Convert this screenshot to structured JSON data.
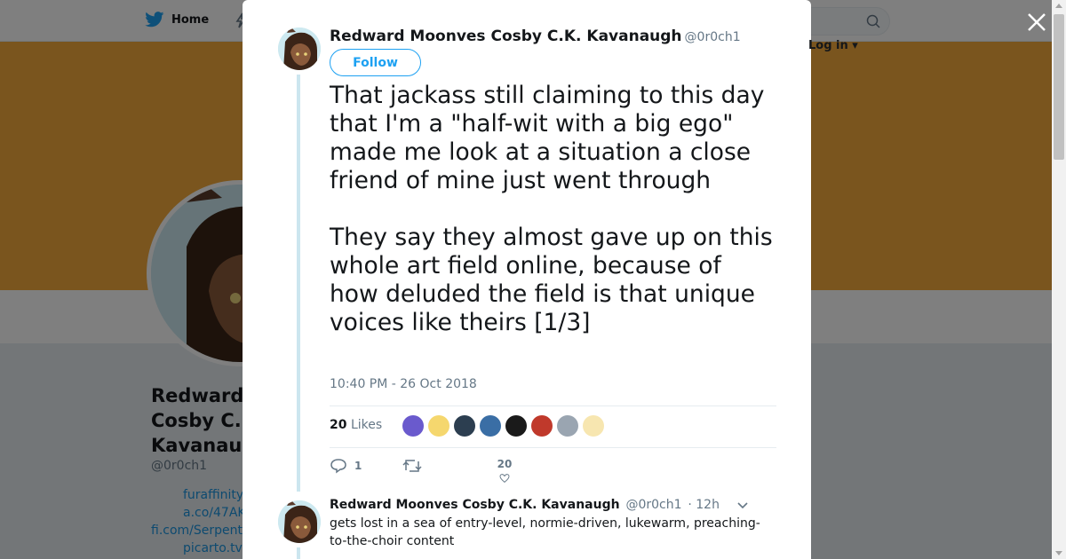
{
  "nav": {
    "home_label": "Home",
    "login_label": "Log in"
  },
  "background_profile": {
    "name": "Redward Cosby C. Kavanau",
    "handle": "@0r0ch1",
    "bio_links": [
      "furaffinity",
      "a.co/47AK",
      "fi.com/Serpent",
      "picarto.tv"
    ],
    "banner_color": "#f4ab3c"
  },
  "tweet": {
    "author_name": "Redward Moonves Cosby C.K. Kavanaugh",
    "author_handle": "@0r0ch1",
    "follow_label": "Follow",
    "paragraphs": [
      "That jackass still claiming to this day that I'm a \"half-wit with a big ego\" made me look at a situation a close friend of mine just went through",
      "They say they almost gave up on this whole art field online, because of how deluded the field is that unique voices like theirs [1/3]"
    ],
    "timestamp": "10:40 PM - 26 Oct 2018",
    "likes_count": "20",
    "likes_label": "Likes",
    "likers": [
      "#6a5acd",
      "#f5d76e",
      "#2c3e50",
      "#3a6ea5",
      "#1a1a1a",
      "#c0392b",
      "#9aa5b1",
      "#f7e6b0"
    ],
    "reply_count": "1",
    "retweet_count": "",
    "like_count": "20"
  },
  "reply": {
    "author_name": "Redward Moonves Cosby C.K. Kavanaugh",
    "author_handle": "@0r0ch1",
    "age": "· 12h",
    "text": "gets lost in a sea of entry-level, normie-driven, lukewarm, preaching-to-the-choir content"
  },
  "colors": {
    "accent": "#1da1f2",
    "thread_line": "#cce6ef"
  }
}
